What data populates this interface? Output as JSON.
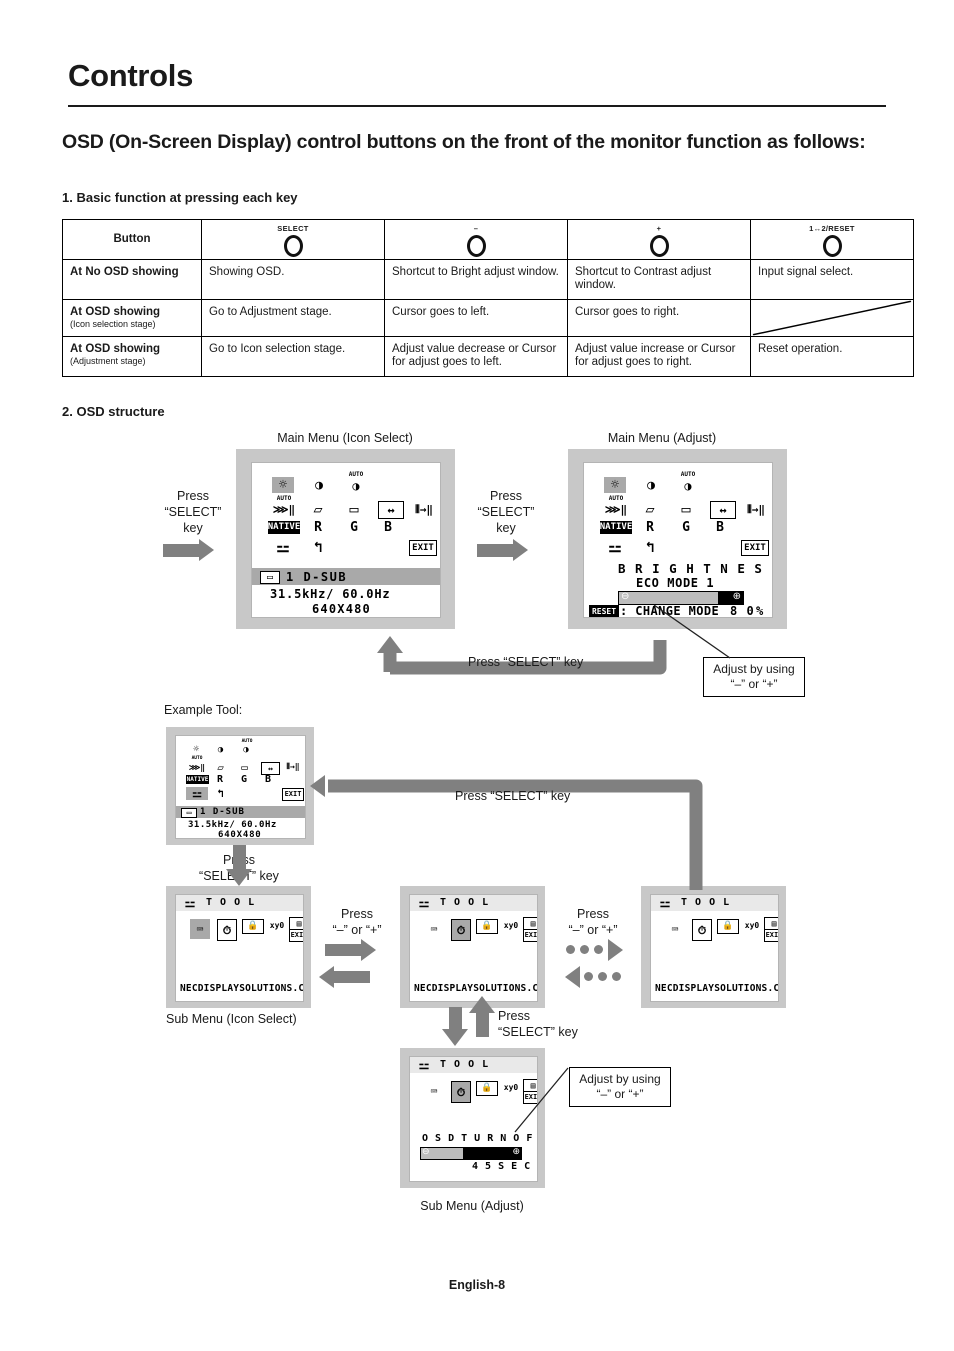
{
  "page": {
    "title": "Controls",
    "subtitle": "OSD (On-Screen Display) control buttons on the front of the monitor function as follows:",
    "section1": "1. Basic function at pressing each key",
    "section2": "2. OSD structure",
    "footer": "English-8"
  },
  "table": {
    "row_header_label": "Button",
    "columns": [
      {
        "label": "SELECT",
        "icon": "button-circle-icon"
      },
      {
        "label": "–",
        "icon": "button-circle-icon"
      },
      {
        "label": "+",
        "icon": "button-circle-icon"
      },
      {
        "label": "1↔2/RESET",
        "icon": "button-circle-icon"
      }
    ],
    "rows": [
      {
        "label": "At No OSD showing",
        "sub": "",
        "cells": [
          "Showing OSD.",
          "Shortcut to Bright adjust window.",
          "Shortcut to Contrast adjust window.",
          "Input signal select."
        ]
      },
      {
        "label": "At OSD showing",
        "sub": "(Icon selection stage)",
        "cells": [
          "Go to Adjustment stage.",
          "Cursor goes to left.",
          "Cursor goes to right.",
          ""
        ]
      },
      {
        "label": "At OSD showing",
        "sub": "(Adjustment stage)",
        "cells": [
          "Go to Icon selection stage.",
          "Adjust value decrease or Cursor for adjust goes to left.",
          "Adjust value increase or Cursor for adjust goes to right.",
          "Reset operation."
        ]
      }
    ]
  },
  "diagram": {
    "caption_main_icon_select": "Main Menu (Icon Select)",
    "caption_main_adjust": "Main Menu (Adjust)",
    "caption_example_tool": "Example Tool:",
    "caption_sub_icon_select": "Sub Menu (Icon Select)",
    "caption_sub_adjust": "Sub Menu (Adjust)",
    "press_select_left": "Press\n“SELECT”\nkey",
    "press_select_mid": "Press\n“SELECT”\nkey",
    "press_select_key": "Press “SELECT” key",
    "press_select_down": "Press\n“SELECT” key",
    "press_select_up": "Press\n“SELECT” key",
    "press_plus_minus_left": "Press\n“–” or “+”",
    "press_plus_minus_right": "Press\n“–” or “+”",
    "callout_adjust": "Adjust by using\n“–” or “+”",
    "callout_adjust_sub": "Adjust by using\n“–” or “+”"
  },
  "osd": {
    "main_icons": [
      {
        "name": "brightness-icon",
        "glyph": "☼",
        "selected_main": true
      },
      {
        "name": "contrast-icon",
        "glyph": "◑",
        "selected_main": false
      },
      {
        "name": "auto-contrast-icon",
        "glyph": "◑",
        "label": "AUTO",
        "selected_main": false
      },
      {
        "name": "auto-adjust-icon",
        "glyph": "⋙→‖",
        "label": "AUTO",
        "selected_main": false
      },
      {
        "name": "h-position-icon",
        "glyph": "◱",
        "selected_main": false
      },
      {
        "name": "v-position-icon",
        "glyph": "◲",
        "selected_main": false
      },
      {
        "name": "h-size-icon",
        "glyph": "↔",
        "selected_main": false
      },
      {
        "name": "sharpness-icon",
        "glyph": "⦀→‖",
        "selected_main": false
      },
      {
        "name": "native-icon",
        "glyph": "NATIVE",
        "selected_main": false
      },
      {
        "name": "red-gain-icon",
        "glyph": "R",
        "selected_main": false
      },
      {
        "name": "green-gain-icon",
        "glyph": "G",
        "selected_main": false
      },
      {
        "name": "blue-gain-icon",
        "glyph": "B",
        "selected_main": false
      },
      {
        "name": "tool-icon",
        "glyph": "⬌",
        "selected_main": false
      },
      {
        "name": "factory-reset-icon",
        "glyph": "↺",
        "selected_main": false
      },
      {
        "name": "exit-icon",
        "glyph": "EXIT",
        "selected_main": false
      }
    ],
    "main_icon_select": {
      "signal_icon": "d-sub-connector-icon",
      "signal_line": "1  D-SUB",
      "freq_line": "31.5kHz/  60.0Hz",
      "resolution_line": "640X480"
    },
    "main_adjust": {
      "title": "B R I G H T N E S S",
      "mode": "ECO MODE 1",
      "reset_badge": "RESET",
      "reset_text": ": CHANGE MODE",
      "value": "8 0",
      "unit": "%",
      "bar_percent": 80,
      "bar_left_icon": "⊖",
      "bar_right_icon": "⊕"
    },
    "sub_menu": {
      "header_icon": "tool-icon",
      "header_label": "T O O L",
      "footer": "NECDISPLAYSOLUTIONS.COM",
      "icons": [
        {
          "name": "language-icon",
          "glyph": "⌨"
        },
        {
          "name": "osd-turn-off-icon",
          "glyph": "⏱"
        },
        {
          "name": "osd-lock-out-icon",
          "glyph": "ὑ2"
        },
        {
          "name": "resolution-notifier-icon",
          "glyph": "xy0"
        },
        {
          "name": "monitor-info-icon",
          "glyph": "☰"
        },
        {
          "name": "exit-icon",
          "glyph": "EXIT"
        }
      ],
      "selected_index_left": 0,
      "selected_index_mid": 1,
      "selected_index_right": -1
    },
    "sub_adjust": {
      "title": "O S D   T U R N   O F F",
      "value": "4 5 S E C .",
      "bar_percent": 42,
      "bar_left_icon": "⊖",
      "bar_right_icon": "⊕"
    }
  }
}
